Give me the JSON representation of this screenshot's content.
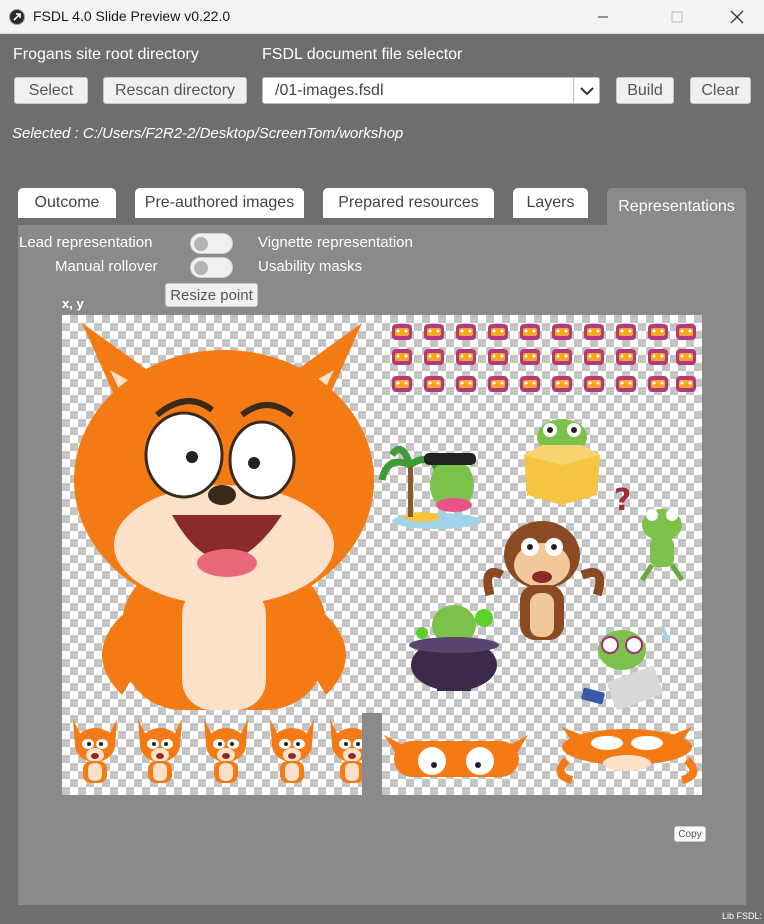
{
  "window": {
    "title": "FSDL 4.0 Slide Preview v0.22.0"
  },
  "toolbar": {
    "root_label": "Frogans site root directory",
    "file_label": "FSDL document file selector",
    "select_btn": "Select",
    "rescan_btn": "Rescan directory",
    "file_value": "/01-images.fsdl",
    "build_btn": "Build",
    "clear_btn": "Clear",
    "selected_path": "Selected : C:/Users/F2R2-2/Desktop/ScreenTom/workshop"
  },
  "tabs": [
    {
      "label": "Outcome",
      "active": false
    },
    {
      "label": "Pre-authored images",
      "active": false
    },
    {
      "label": "Prepared resources",
      "active": false
    },
    {
      "label": "Layers",
      "active": false
    },
    {
      "label": "Representations",
      "active": true
    }
  ],
  "options": {
    "lead": "Lead representation",
    "manual": "Manual rollover",
    "vignette": "Vignette representation",
    "usability": "Usability masks",
    "resize": "Resize point",
    "xy": "x, y"
  },
  "footer": {
    "copy": "Copy",
    "lib": "Lib FSDL:"
  },
  "colors": {
    "fox_orange": "#f47a14",
    "frog_green": "#7cc24a",
    "monkey_brown": "#8a4b24",
    "box_yellow": "#f5c542"
  }
}
